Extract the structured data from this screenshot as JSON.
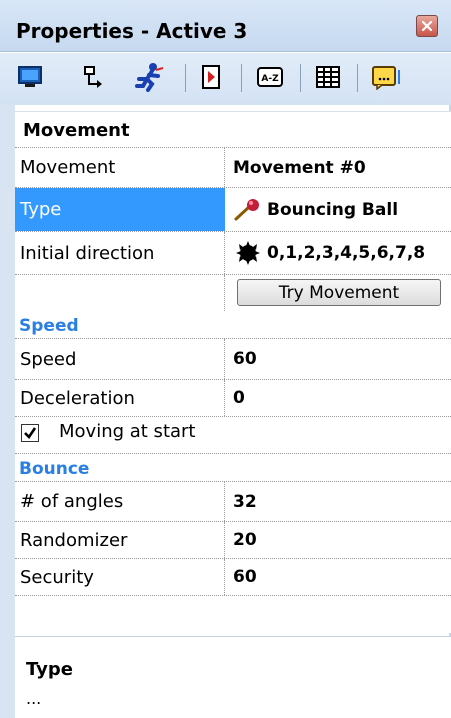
{
  "window": {
    "title": "Properties - Active 3"
  },
  "toolbar": {
    "buttons": [
      {
        "icon": "display-icon"
      },
      {
        "icon": "values-icon"
      },
      {
        "icon": "movement-icon"
      },
      {
        "icon": "events-icon"
      },
      {
        "icon": "about-icon"
      },
      {
        "icon": "grid-icon"
      },
      {
        "icon": "runtime-icon"
      }
    ]
  },
  "grid": {
    "section_movement": "Movement",
    "movement_name": "Movement",
    "movement_value": "Movement #0",
    "type_name": "Type",
    "type_value": "Bouncing Ball",
    "initial_direction_name": "Initial direction",
    "initial_direction_value": "0,1,2,3,4,5,6,7,8",
    "try_button": "Try Movement",
    "section_speed": "Speed",
    "speed_name": "Speed",
    "speed_value": "60",
    "deceleration_name": "Deceleration",
    "deceleration_value": "0",
    "moving_at_start_label": "Moving at start",
    "moving_at_start_checked": true,
    "section_bounce": "Bounce",
    "angles_name": "# of angles",
    "angles_value": "32",
    "randomizer_name": "Randomizer",
    "randomizer_value": "20",
    "security_name": "Security",
    "security_value": "60"
  },
  "description": {
    "title": "Type",
    "text": "..."
  },
  "colors": {
    "selection": "#3399ff",
    "category": "#2a7fe3",
    "titlebar": "#c6d9f0"
  }
}
